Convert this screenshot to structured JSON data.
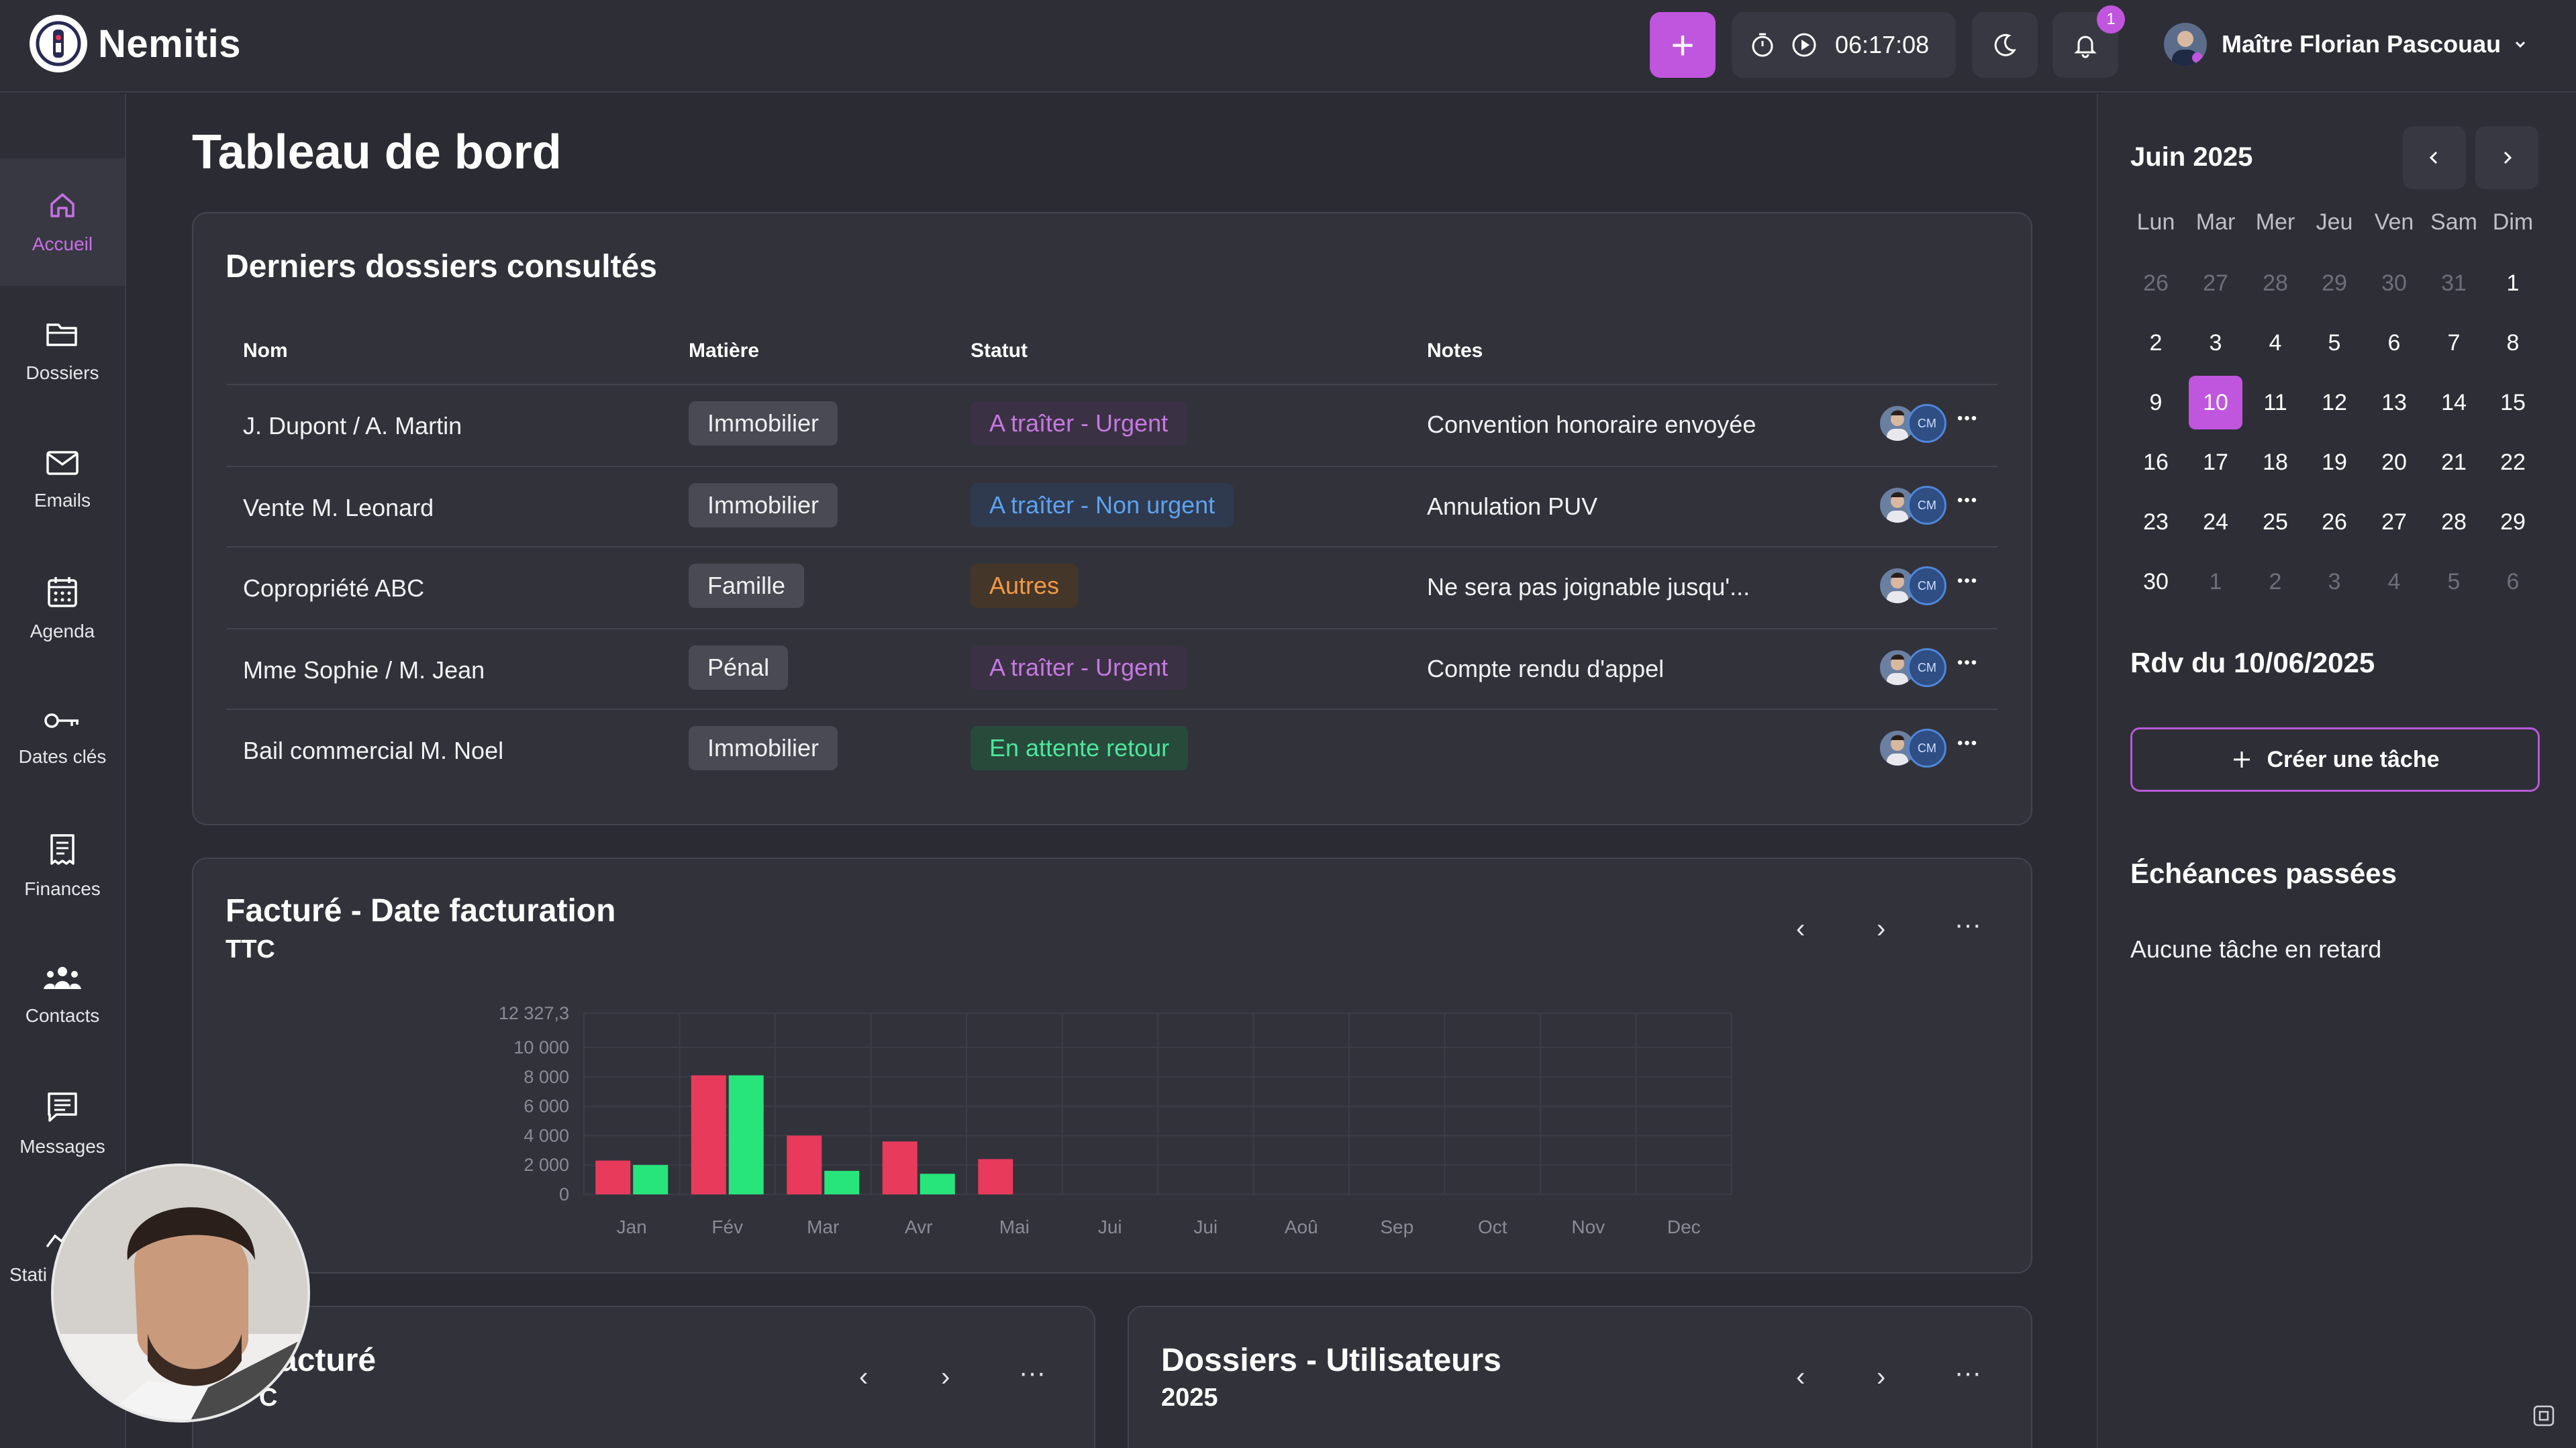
{
  "app": {
    "name": "Nemitis"
  },
  "topbar": {
    "timer": "06:17:08",
    "notification_count": "1",
    "user_name": "Maître Florian Pascouau"
  },
  "sidebar": {
    "items": [
      {
        "label": "Accueil",
        "icon": "home-icon",
        "active": true
      },
      {
        "label": "Dossiers",
        "icon": "folder-icon"
      },
      {
        "label": "Emails",
        "icon": "mail-icon"
      },
      {
        "label": "Agenda",
        "icon": "calendar-icon"
      },
      {
        "label": "Dates clés",
        "icon": "key-icon"
      },
      {
        "label": "Finances",
        "icon": "receipt-icon"
      },
      {
        "label": "Contacts",
        "icon": "users-icon"
      },
      {
        "label": "Messages",
        "icon": "message-icon"
      },
      {
        "label": "Stati",
        "icon": "stats-icon"
      }
    ]
  },
  "page": {
    "title": "Tableau de bord"
  },
  "recent": {
    "title": "Derniers dossiers consultés",
    "headers": {
      "name": "Nom",
      "matter": "Matière",
      "status": "Statut",
      "notes": "Notes"
    },
    "avatar_initials": "CM",
    "rows": [
      {
        "name": "J. Dupont / A. Martin",
        "matter": "Immobilier",
        "status": "A traîter - Urgent",
        "status_kind": "urgent",
        "notes": "Convention honoraire envoyée"
      },
      {
        "name": "Vente M. Leonard",
        "matter": "Immobilier",
        "status": "A traîter - Non urgent",
        "status_kind": "nonurgent",
        "notes": "Annulation PUV"
      },
      {
        "name": "Copropriété ABC",
        "matter": "Famille",
        "status": "Autres",
        "status_kind": "autres",
        "notes": "Ne sera pas joignable jusqu'..."
      },
      {
        "name": "Mme Sophie / M. Jean",
        "matter": "Pénal",
        "status": "A traîter - Urgent",
        "status_kind": "urgent",
        "notes": "Compte rendu d'appel"
      },
      {
        "name": "Bail commercial M. Noel",
        "matter": "Immobilier",
        "status": "En attente retour",
        "status_kind": "attente",
        "notes": ""
      }
    ]
  },
  "billing_card": {
    "title": "Facturé - Date facturation",
    "subtitle": "TTC"
  },
  "chart_data": {
    "type": "bar",
    "categories": [
      "Jan",
      "Fév",
      "Mar",
      "Avr",
      "Mai",
      "Jui",
      "Jui",
      "Aoû",
      "Sep",
      "Oct",
      "Nov",
      "Dec"
    ],
    "y_tick_labels": [
      "0",
      "2 000",
      "4 000",
      "6 000",
      "8 000",
      "10 000",
      "12 327,3"
    ],
    "y_ticks": [
      0,
      2000,
      4000,
      6000,
      8000,
      10000,
      12327.3
    ],
    "ylim": [
      0,
      12327.3
    ],
    "grid": true,
    "series": [
      {
        "color": "#e83a5a",
        "values": [
          2300,
          8100,
          4000,
          3600,
          2400,
          0,
          0,
          0,
          0,
          0,
          0,
          0
        ]
      },
      {
        "color": "#27e57a",
        "values": [
          2000,
          8100,
          1600,
          1400,
          0,
          0,
          0,
          0,
          0,
          0,
          0,
          0
        ]
      }
    ]
  },
  "bottom_left_card": {
    "title": "acturé",
    "subtitle": "C"
  },
  "bottom_right_card": {
    "title": "Dossiers - Utilisateurs",
    "subtitle": "2025"
  },
  "calendar": {
    "month": "Juin 2025",
    "weekdays": [
      "Lun",
      "Mar",
      "Mer",
      "Jeu",
      "Ven",
      "Sam",
      "Dim"
    ],
    "weeks": [
      [
        "26",
        "27",
        "28",
        "29",
        "30",
        "31",
        "1"
      ],
      [
        "2",
        "3",
        "4",
        "5",
        "6",
        "7",
        "8"
      ],
      [
        "9",
        "10",
        "11",
        "12",
        "13",
        "14",
        "15"
      ],
      [
        "16",
        "17",
        "18",
        "19",
        "20",
        "21",
        "22"
      ],
      [
        "23",
        "24",
        "25",
        "26",
        "27",
        "28",
        "29"
      ],
      [
        "30",
        "1",
        "2",
        "3",
        "4",
        "5",
        "6"
      ]
    ],
    "today": "10"
  },
  "agenda": {
    "rdv_title": "Rdv du 10/06/2025",
    "create_label": "Créer une tâche",
    "past_title": "Échéances passées",
    "past_empty": "Aucune tâche en retard"
  }
}
